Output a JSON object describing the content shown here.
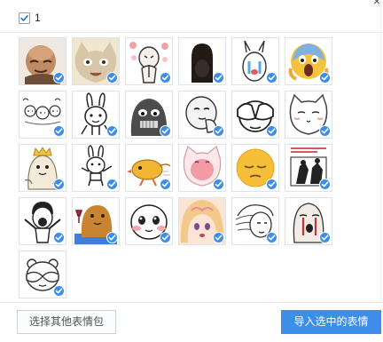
{
  "dialog": {
    "close_symbol": "×",
    "close_icon": "close-icon"
  },
  "header": {
    "select_all_label": "1",
    "select_all_checked": true
  },
  "stickers": [
    {
      "icon": "sticker-bald-man-icon",
      "checked": true
    },
    {
      "icon": "sticker-cat-face-icon",
      "checked": true
    },
    {
      "icon": "sticker-flowers-pray-icon",
      "checked": true
    },
    {
      "icon": "sticker-black-silhouette-icon",
      "checked": true
    },
    {
      "icon": "sticker-crying-bunny-icon",
      "checked": true
    },
    {
      "icon": "sticker-screaming-face-icon",
      "checked": true
    },
    {
      "icon": "sticker-doodle-faces-icon",
      "checked": true
    },
    {
      "icon": "sticker-bunny-line-icon",
      "checked": true
    },
    {
      "icon": "sticker-gray-blob-icon",
      "checked": true
    },
    {
      "icon": "sticker-face-hand-icon",
      "checked": true
    },
    {
      "icon": "sticker-facepalm-icon",
      "checked": true
    },
    {
      "icon": "sticker-white-cat-icon",
      "checked": true
    },
    {
      "icon": "sticker-crowned-cat-icon",
      "checked": true
    },
    {
      "icon": "sticker-dancing-bunny-icon",
      "checked": true
    },
    {
      "icon": "sticker-running-chick-icon",
      "checked": true
    },
    {
      "icon": "sticker-pink-cat-icon",
      "checked": true
    },
    {
      "icon": "sticker-sleepy-emoji-icon",
      "checked": true
    },
    {
      "icon": "sticker-comic-panel-icon",
      "checked": true
    },
    {
      "icon": "sticker-shouting-man-icon",
      "checked": true
    },
    {
      "icon": "sticker-bear-wine-icon",
      "checked": true
    },
    {
      "icon": "sticker-blushing-face-icon",
      "checked": true
    },
    {
      "icon": "sticker-anime-girl-icon",
      "checked": true
    },
    {
      "icon": "sticker-windblown-hair-icon",
      "checked": true
    },
    {
      "icon": "sticker-crying-sketch-icon",
      "checked": true
    },
    {
      "icon": "sticker-hiding-bear-icon",
      "checked": true
    }
  ],
  "footer": {
    "choose_other_label": "选择其他表情包",
    "import_selected_label": "导入选中的表情"
  },
  "colors": {
    "accent": "#3d8ee8",
    "border": "#dde3ec"
  }
}
